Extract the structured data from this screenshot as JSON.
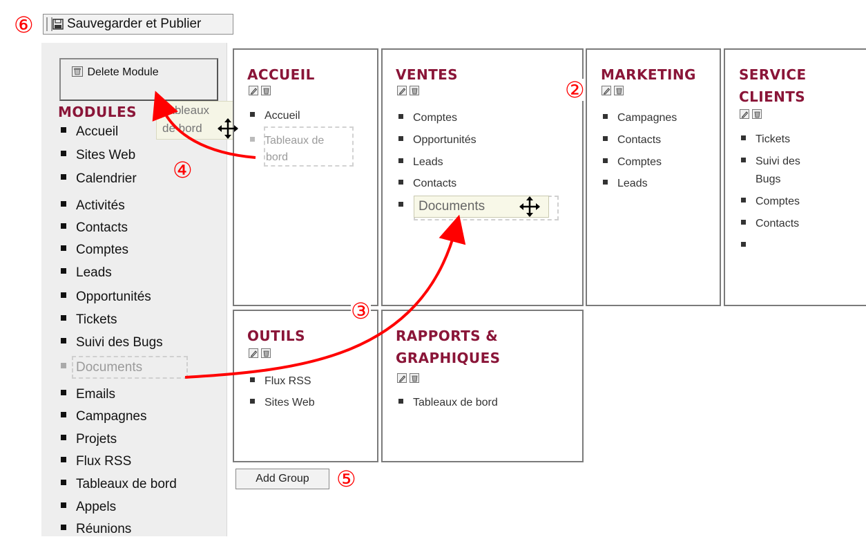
{
  "annotations": {
    "n6": "⑥",
    "n2": "②",
    "n3": "③",
    "n4": "④",
    "n5": "⑤"
  },
  "toolbar": {
    "save_label": "Sauvegarder et Publier"
  },
  "sidebar": {
    "delete_label": "Delete Module",
    "title": "MODULES",
    "items": [
      "Accueil",
      "Sites Web",
      "Calendrier",
      "Activités",
      "Contacts",
      "Comptes",
      "Leads",
      "Opportunités",
      "Tickets",
      "Suivi des Bugs",
      "Documents",
      "Emails",
      "Campagnes",
      "Projets",
      "Flux RSS",
      "Tableaux de bord",
      "Appels",
      "Réunions"
    ],
    "drag_tip_line1": "Tableaux",
    "drag_tip_line2": "de bord"
  },
  "groups": {
    "accueil": {
      "title": "ACCUEIL",
      "items": [
        "Accueil",
        "Tableaux de",
        "bord"
      ]
    },
    "ventes": {
      "title": "VENTES",
      "items": [
        "Comptes",
        "Opportunités",
        "Leads",
        "Contacts",
        "Documents"
      ]
    },
    "marketing": {
      "title": "MARKETING",
      "items": [
        "Campagnes",
        "Contacts",
        "Comptes",
        "Leads"
      ]
    },
    "service": {
      "title_line1": "SERVICE",
      "title_line2": "CLIENTS",
      "items": [
        "Tickets",
        "Suivi des",
        "Bugs",
        "Comptes",
        "Contacts"
      ]
    },
    "outils": {
      "title": "OUTILS",
      "items": [
        "Flux RSS",
        "Sites Web"
      ]
    },
    "rapports": {
      "title_line1": "RAPPORTS &",
      "title_line2": "GRAPHIQUES",
      "items": [
        "Tableaux de bord"
      ]
    }
  },
  "add_group_label": "Add Group",
  "colors": {
    "accent": "#8a1538",
    "arrow": "#ff0000"
  }
}
